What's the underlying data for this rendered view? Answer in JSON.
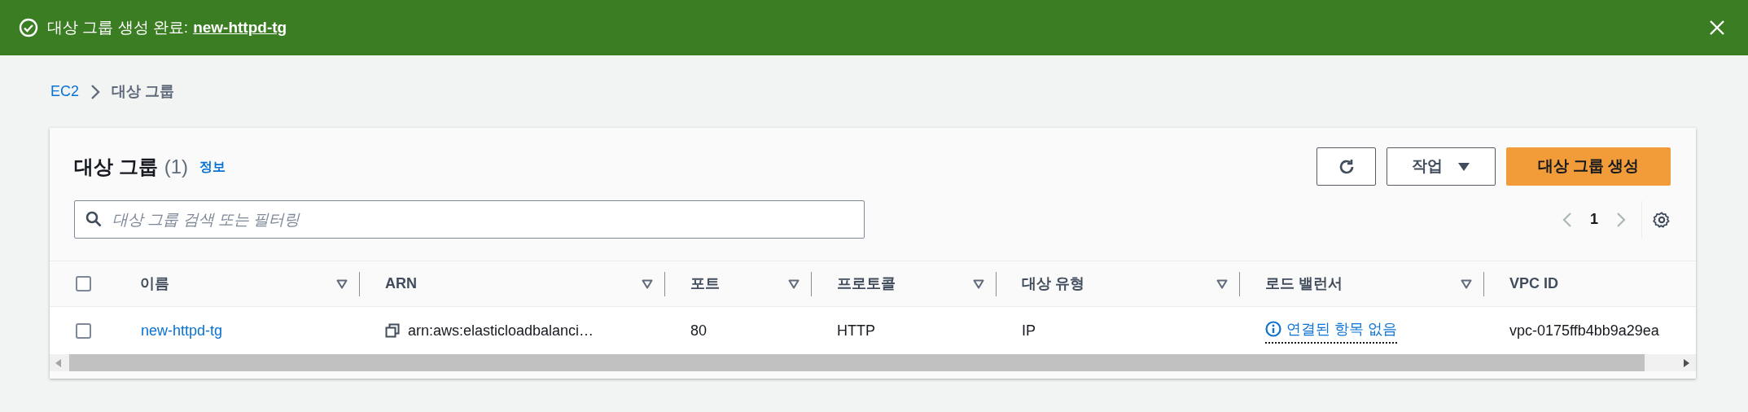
{
  "notification": {
    "message": "대상 그룹 생성 완료:",
    "link": "new-httpd-tg"
  },
  "breadcrumb": [
    {
      "label": "EC2",
      "link": true
    },
    {
      "label": "대상 그룹",
      "link": false
    }
  ],
  "header": {
    "title": "대상 그룹",
    "count": "(1)",
    "info": "정보"
  },
  "buttons": {
    "actions": "작업",
    "create": "대상 그룹 생성"
  },
  "search": {
    "placeholder": "대상 그룹 검색 또는 필터링"
  },
  "pagination": {
    "page": "1"
  },
  "table": {
    "select_all": {
      "checked": false
    },
    "columns": [
      {
        "label": "이름",
        "sortable": true
      },
      {
        "label": "ARN",
        "sortable": true
      },
      {
        "label": "포트",
        "sortable": true
      },
      {
        "label": "프로토콜",
        "sortable": true
      },
      {
        "label": "대상 유형",
        "sortable": true
      },
      {
        "label": "로드 밸런서",
        "sortable": true
      },
      {
        "label": "VPC ID",
        "sortable": false
      }
    ],
    "rows": [
      {
        "checked": false,
        "cells": [
          {
            "kind": "link",
            "text": "new-httpd-tg"
          },
          {
            "kind": "copy",
            "text": "arn:aws:elasticloadbalanci…"
          },
          {
            "kind": "text",
            "text": "80"
          },
          {
            "kind": "text",
            "text": "HTTP"
          },
          {
            "kind": "text",
            "text": "IP"
          },
          {
            "kind": "info-link",
            "text": "연결된 항목 없음"
          },
          {
            "kind": "text",
            "text": "vpc-0175ffb4bb9a29ea"
          }
        ]
      }
    ]
  }
}
